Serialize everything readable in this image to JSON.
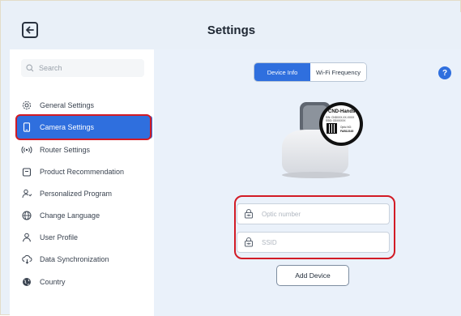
{
  "header": {
    "title": "Settings",
    "back_icon": "arrow-left-icon"
  },
  "sidebar": {
    "search_placeholder": "Search",
    "items": [
      {
        "label": "General Settings",
        "icon": "gear-icon",
        "active": false
      },
      {
        "label": "Camera Settings",
        "icon": "phone-icon",
        "active": true
      },
      {
        "label": "Router Settings",
        "icon": "signal-icon",
        "active": false
      },
      {
        "label": "Product Recommendation",
        "icon": "bag-icon",
        "active": false
      },
      {
        "label": "Personalized Program",
        "icon": "person-star-icon",
        "active": false
      },
      {
        "label": "Change Language",
        "icon": "globe-icon",
        "active": false
      },
      {
        "label": "User Profile",
        "icon": "user-icon",
        "active": false
      },
      {
        "label": "Data Synchronization",
        "icon": "cloud-sync-icon",
        "active": false
      },
      {
        "label": "Country",
        "icon": "globe-filled-icon",
        "active": false
      }
    ]
  },
  "main": {
    "tabs": [
      {
        "label": "Device Info",
        "active": true
      },
      {
        "label": "Wi-Fi Frequency",
        "active": false
      }
    ],
    "help_label": "?",
    "device_label": {
      "brand": "CND-Handset",
      "sn": "S/N: CNDXXX-XX-XXXX",
      "ssid": "SSID: DDXXXXX",
      "optic_no_label": "Optic NO:",
      "optic_no": "FAB12345"
    },
    "optic_input": {
      "placeholder": "Optic number",
      "value": ""
    },
    "ssid_input": {
      "placeholder": "SSID",
      "value": ""
    },
    "add_button": "Add Device"
  },
  "colors": {
    "accent": "#2f6fde",
    "highlight": "#d21b25",
    "background": "#eaf1fa"
  }
}
